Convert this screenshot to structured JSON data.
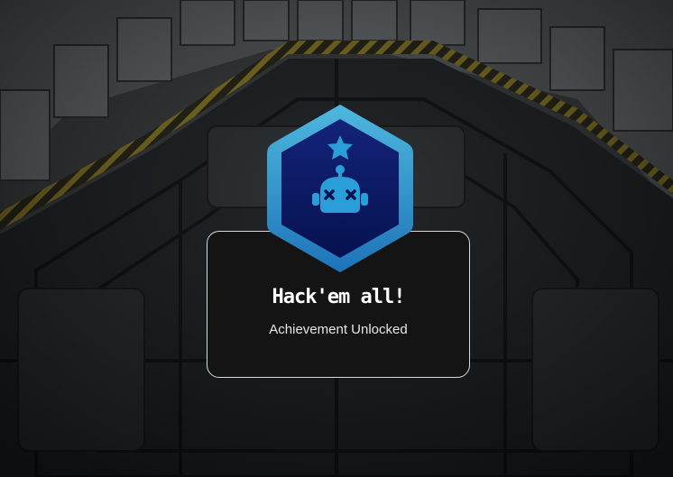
{
  "achievement": {
    "title": "Hack'em all!",
    "subtitle": "Achievement Unlocked",
    "badge_icon": "robot-icon",
    "badge_top_icon": "star-icon",
    "badge_colors": {
      "outer": "#3aa6d4",
      "inner": "#0b1a66",
      "icon": "#2a9ed8"
    }
  },
  "background": {
    "scene": "sci-fi hangar floor viewed from above"
  }
}
